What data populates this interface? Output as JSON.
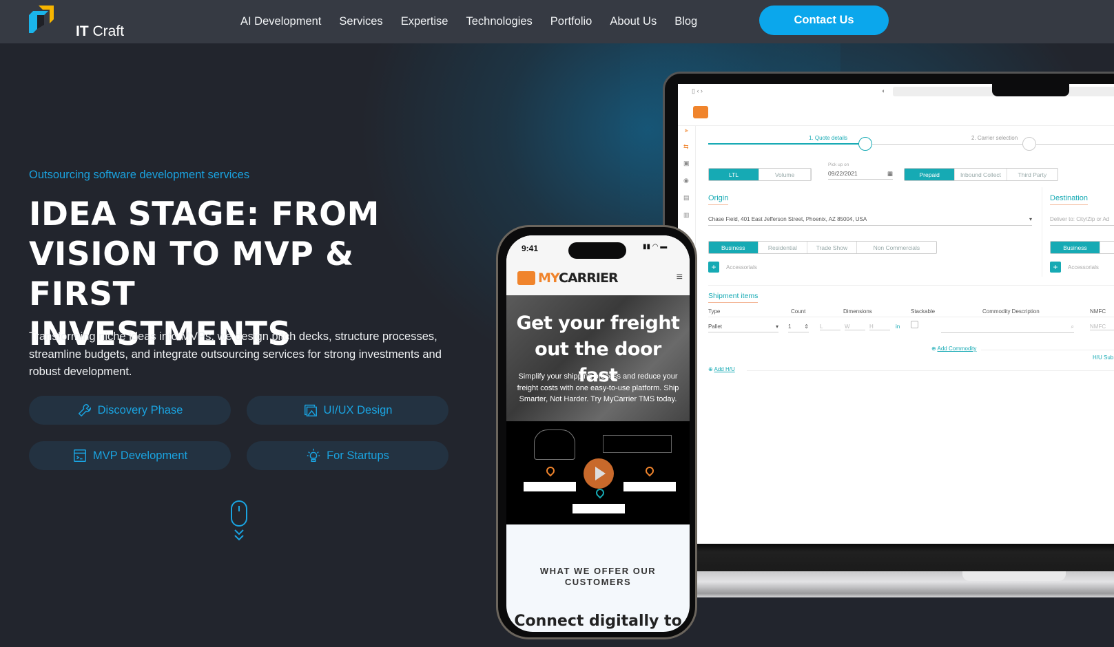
{
  "header": {
    "logo_bold": "IT",
    "logo_light": "Craft",
    "nav": [
      "AI Development",
      "Services",
      "Expertise",
      "Technologies",
      "Portfolio",
      "About Us",
      "Blog"
    ],
    "cta": "Contact Us"
  },
  "hero": {
    "eyebrow": "Outsourcing software development services",
    "title_lines": [
      "IDEA STAGE: FROM",
      "VISION TO MVP & FIRST",
      "INVESTMENTS"
    ],
    "description": "Transforming niche ideas into MVPs, we design pitch decks, structure processes, streamline budgets, and integrate outsourcing services for strong investments and robust development.",
    "pills": [
      {
        "label": "Discovery Phase",
        "icon": "wrench-icon"
      },
      {
        "label": "UI/UX Design",
        "icon": "image-gallery-icon"
      },
      {
        "label": "MVP Development",
        "icon": "terminal-window-icon"
      },
      {
        "label": "For Startups",
        "icon": "lightbulb-icon"
      }
    ],
    "scroll_icon": "mouse-scroll-icon"
  },
  "colors": {
    "accent": "#0ba7ec",
    "teal": "#16aab4",
    "orange": "#f0842c",
    "bg": "#22252d",
    "header": "#363a43",
    "pill": "#233241"
  },
  "laptop_app": {
    "steps": [
      "1. Quote details",
      "2. Carrier selection"
    ],
    "mode_toggle": [
      "LTL",
      "Volume"
    ],
    "pickup_label": "Pick up on",
    "pickup_date": "09/22/2021",
    "payment": [
      "Prepaid",
      "Inbound Collect",
      "Third Party"
    ],
    "origin_title": "Origin",
    "origin_address": "Chase Field, 401 East Jefferson Street, Phoenix, AZ 85004, USA",
    "location_types": [
      "Business",
      "Residential",
      "Trade Show",
      "Non Commercials"
    ],
    "accessorials": "Accessorials",
    "destination_title": "Destination",
    "destination_placeholder": "Deliver to: City/Zip or Ad",
    "dest_type": "Business",
    "shipment_title": "Shipment items",
    "columns": [
      "Type",
      "Count",
      "Dimensions",
      "Stackable",
      "Commodity Description",
      "NMFC"
    ],
    "row": {
      "type": "Pallet",
      "count": "1",
      "l": "L",
      "w": "W",
      "h": "H",
      "unit": "in",
      "nmfc": "NMFC"
    },
    "add_commodity": "Add Commodity",
    "add_hu": "Add H/U",
    "hu_sub": "H/U Sub"
  },
  "phone_app": {
    "time": "9:41",
    "brand": "MYCARRIER",
    "headline": "Get your freight out the door fast",
    "body": "Simplify your shipping process and reduce your freight costs with one easy-to-use platform. Ship Smarter, Not Harder. Try MyCarrier TMS today.",
    "offer": "WHAT WE OFFER OUR CUSTOMERS",
    "connect": "Connect digitally to"
  }
}
